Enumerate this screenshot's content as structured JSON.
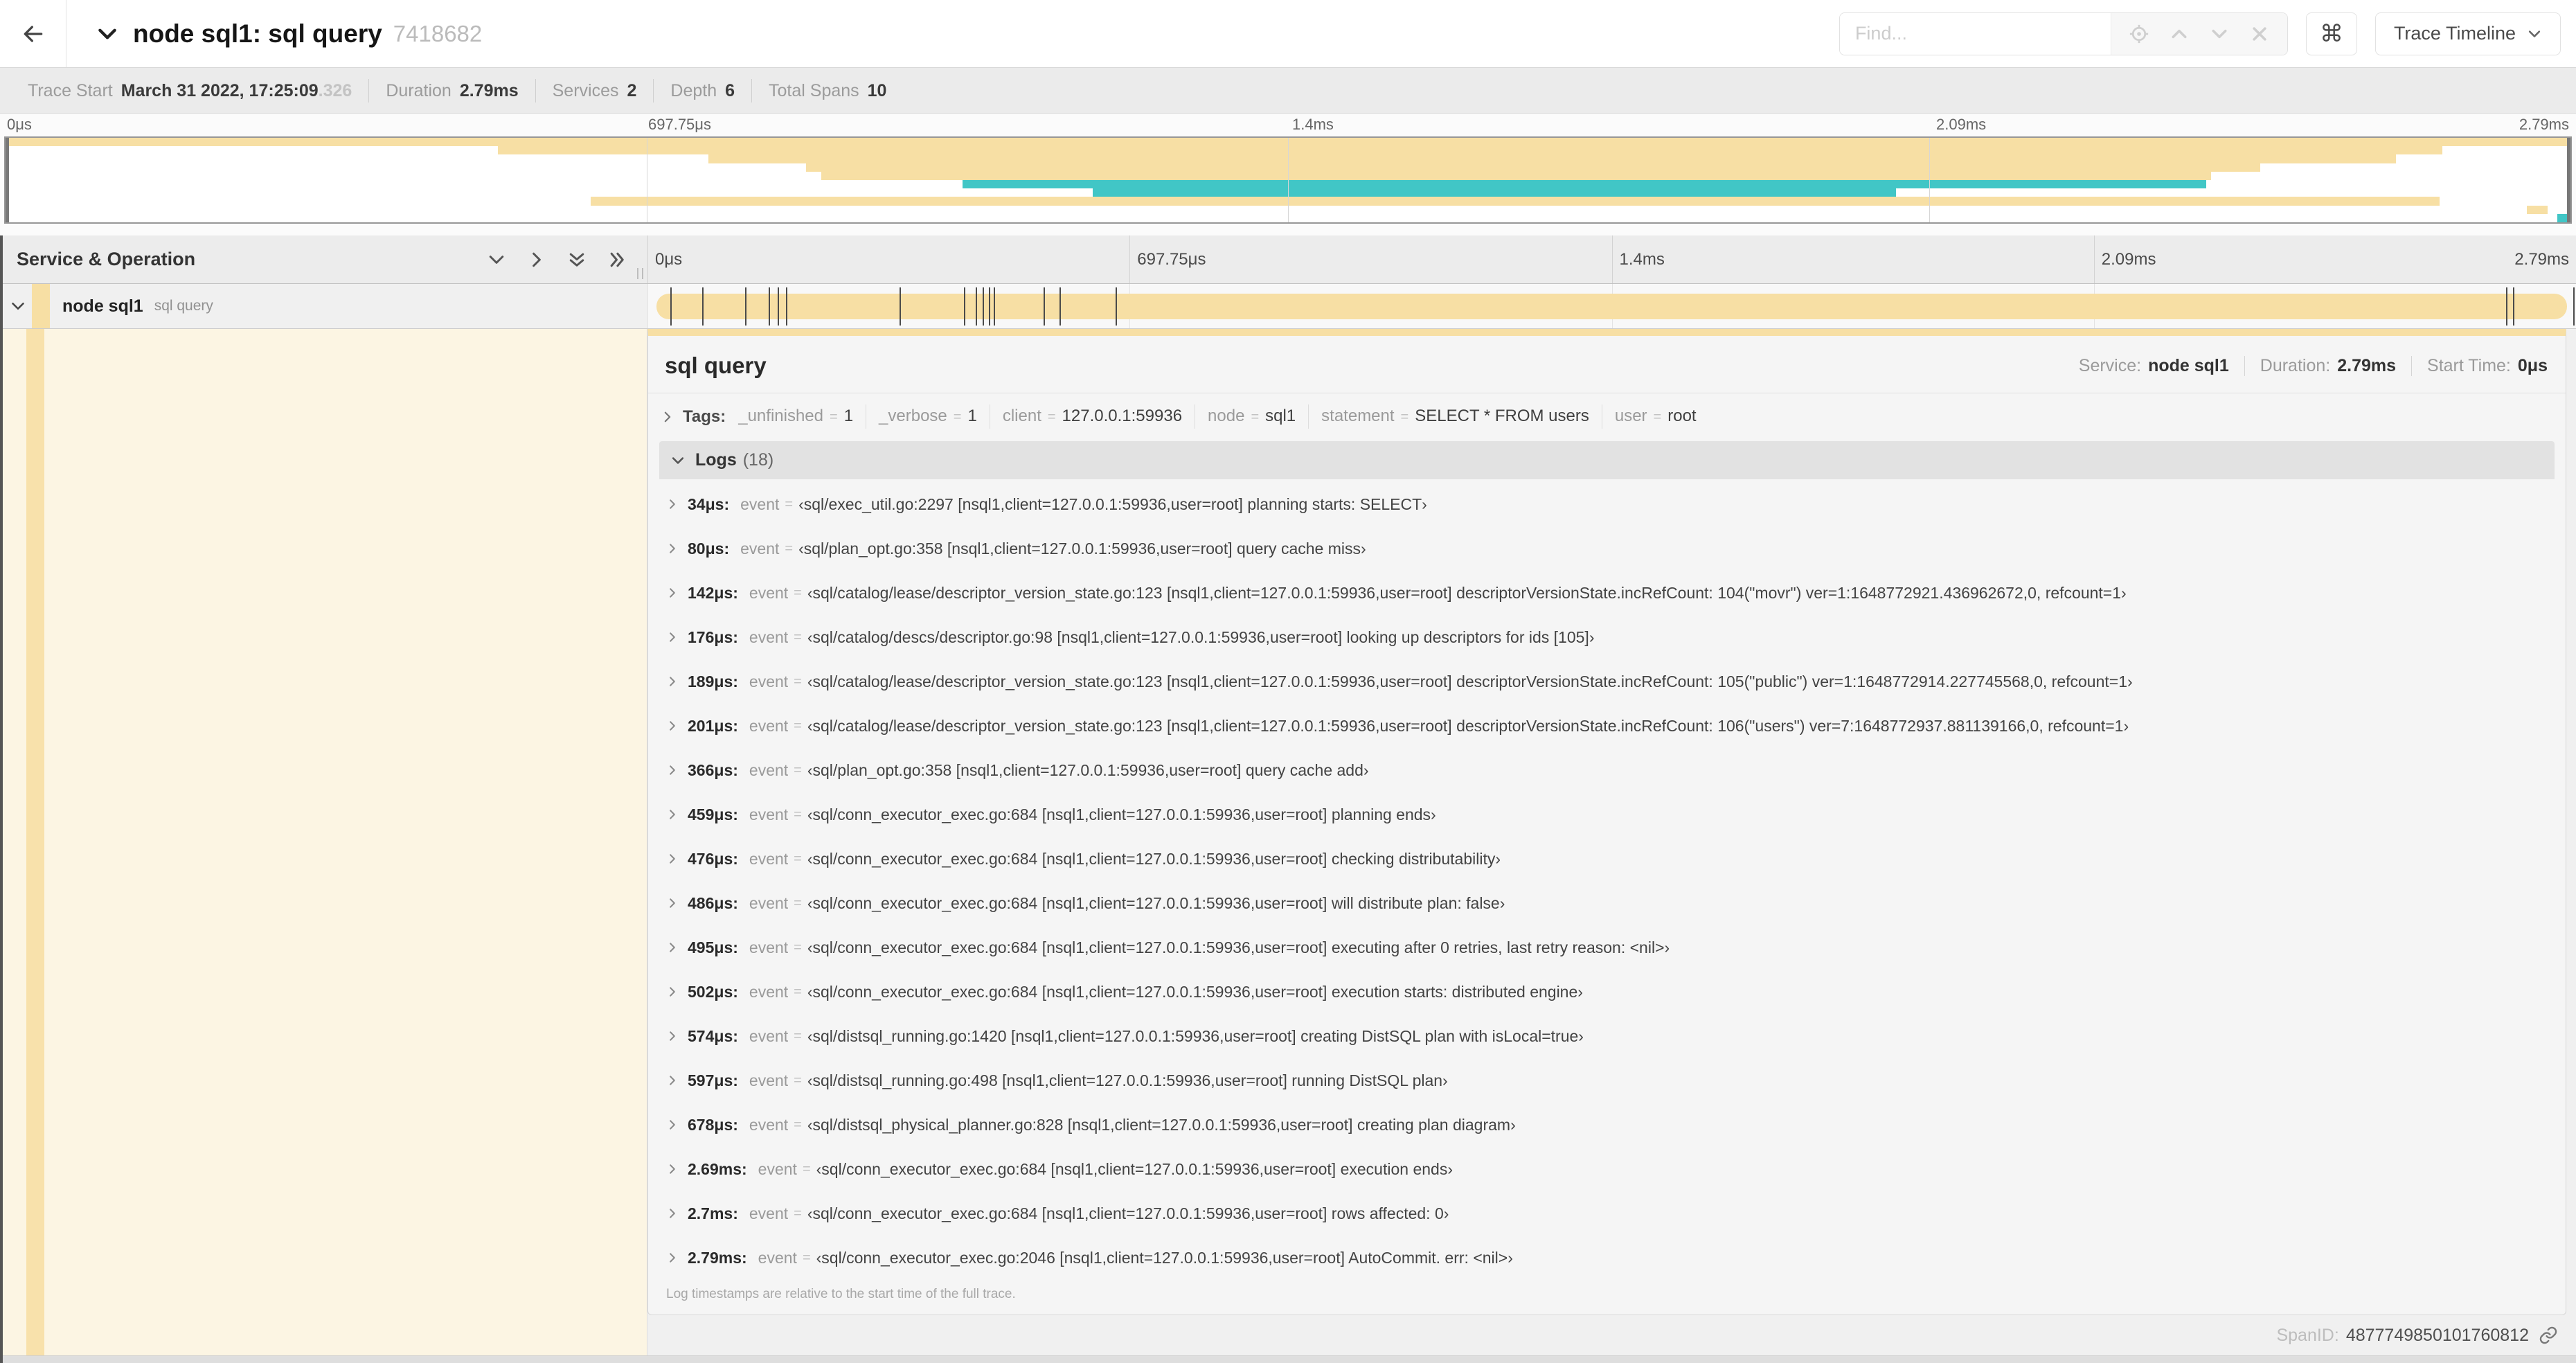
{
  "colors": {
    "span_bar": "#F7DFA4",
    "secondary_span": "#41C6C6",
    "detail_accent": "#F7DFA4"
  },
  "header": {
    "title": "node sql1: sql query",
    "trace_id": "7418682",
    "find_placeholder": "Find...",
    "command_icon": "⌘",
    "view_button": "Trace Timeline"
  },
  "summary": [
    {
      "label": "Trace Start",
      "value": "March 31 2022, 17:25:09",
      "suffix": ".326"
    },
    {
      "label": "Duration",
      "value": "2.79ms"
    },
    {
      "label": "Services",
      "value": "2"
    },
    {
      "label": "Depth",
      "value": "6"
    },
    {
      "label": "Total Spans",
      "value": "10"
    }
  ],
  "timeline": {
    "duration_us": 2790,
    "ticks": [
      "0μs",
      "697.75μs",
      "1.4ms",
      "2.09ms",
      "2.79ms"
    ],
    "service_operation_header": "Service & Operation",
    "row": {
      "service": "node sql1",
      "operation": "sql query"
    },
    "minimap_rows": [
      {
        "start_pct": 0,
        "end_pct": 100,
        "color": "#F7DFA4"
      },
      {
        "start_pct": 19.2,
        "end_pct": 95.0,
        "color": "#F7DFA4"
      },
      {
        "start_pct": 27.4,
        "end_pct": 93.2,
        "color": "#F7DFA4"
      },
      {
        "start_pct": 31.2,
        "end_pct": 87.9,
        "color": "#F7DFA4"
      },
      {
        "start_pct": 31.8,
        "end_pct": 86.0,
        "color": "#F7DFA4"
      },
      {
        "start_pct": 37.3,
        "end_pct": 85.8,
        "color": "#41C6C6"
      },
      {
        "start_pct": 42.4,
        "end_pct": 73.7,
        "color": "#41C6C6"
      },
      {
        "start_pct": 22.8,
        "end_pct": 94.9,
        "color": "#F7DFA4"
      },
      {
        "start_pct": 98.3,
        "end_pct": 99.1,
        "color": "#F7DFA4"
      },
      {
        "start_pct": 99.5,
        "end_pct": 100,
        "color": "#41C6C6"
      }
    ]
  },
  "detail": {
    "title": "sql query",
    "service": {
      "label": "Service:",
      "value": "node sql1"
    },
    "duration": {
      "label": "Duration:",
      "value": "2.79ms"
    },
    "start_time": {
      "label": "Start Time:",
      "value": "0μs"
    },
    "tags_label": "Tags:",
    "tags": [
      {
        "key": "_unfinished",
        "value": "1"
      },
      {
        "key": "_verbose",
        "value": "1"
      },
      {
        "key": "client",
        "value": "127.0.0.1:59936"
      },
      {
        "key": "node",
        "value": "sql1"
      },
      {
        "key": "statement",
        "value": "SELECT * FROM users"
      },
      {
        "key": "user",
        "value": "root"
      }
    ],
    "logs_label": "Logs",
    "logs_count": "(18)",
    "log_key": "event",
    "logs": [
      {
        "time": "34μs",
        "t_us": 34,
        "value": "‹sql/exec_util.go:2297 [nsql1,client=127.0.0.1:59936,user=root] planning starts: SELECT›"
      },
      {
        "time": "80μs",
        "t_us": 80,
        "value": "‹sql/plan_opt.go:358 [nsql1,client=127.0.0.1:59936,user=root] query cache miss›"
      },
      {
        "time": "142μs",
        "t_us": 142,
        "value": "‹sql/catalog/lease/descriptor_version_state.go:123 [nsql1,client=127.0.0.1:59936,user=root] descriptorVersionState.incRefCount: 104(\"movr\") ver=1:1648772921.436962672,0, refcount=1›"
      },
      {
        "time": "176μs",
        "t_us": 176,
        "value": "‹sql/catalog/descs/descriptor.go:98 [nsql1,client=127.0.0.1:59936,user=root] looking up descriptors for ids [105]›"
      },
      {
        "time": "189μs",
        "t_us": 189,
        "value": "‹sql/catalog/lease/descriptor_version_state.go:123 [nsql1,client=127.0.0.1:59936,user=root] descriptorVersionState.incRefCount: 105(\"public\") ver=1:1648772914.227745568,0, refcount=1›"
      },
      {
        "time": "201μs",
        "t_us": 201,
        "value": "‹sql/catalog/lease/descriptor_version_state.go:123 [nsql1,client=127.0.0.1:59936,user=root] descriptorVersionState.incRefCount: 106(\"users\") ver=7:1648772937.881139166,0, refcount=1›"
      },
      {
        "time": "366μs",
        "t_us": 366,
        "value": "‹sql/plan_opt.go:358 [nsql1,client=127.0.0.1:59936,user=root] query cache add›"
      },
      {
        "time": "459μs",
        "t_us": 459,
        "value": "‹sql/conn_executor_exec.go:684 [nsql1,client=127.0.0.1:59936,user=root] planning ends›"
      },
      {
        "time": "476μs",
        "t_us": 476,
        "value": "‹sql/conn_executor_exec.go:684 [nsql1,client=127.0.0.1:59936,user=root] checking distributability›"
      },
      {
        "time": "486μs",
        "t_us": 486,
        "value": "‹sql/conn_executor_exec.go:684 [nsql1,client=127.0.0.1:59936,user=root] will distribute plan: false›"
      },
      {
        "time": "495μs",
        "t_us": 495,
        "value": "‹sql/conn_executor_exec.go:684 [nsql1,client=127.0.0.1:59936,user=root] executing after 0 retries, last retry reason: <nil>›"
      },
      {
        "time": "502μs",
        "t_us": 502,
        "value": "‹sql/conn_executor_exec.go:684 [nsql1,client=127.0.0.1:59936,user=root] execution starts: distributed engine›"
      },
      {
        "time": "574μs",
        "t_us": 574,
        "value": "‹sql/distsql_running.go:1420 [nsql1,client=127.0.0.1:59936,user=root] creating DistSQL plan with isLocal=true›"
      },
      {
        "time": "597μs",
        "t_us": 597,
        "value": "‹sql/distsql_running.go:498 [nsql1,client=127.0.0.1:59936,user=root] running DistSQL plan›"
      },
      {
        "time": "678μs",
        "t_us": 678,
        "value": "‹sql/distsql_physical_planner.go:828 [nsql1,client=127.0.0.1:59936,user=root] creating plan diagram›"
      },
      {
        "time": "2.69ms",
        "t_us": 2690,
        "value": "‹sql/conn_executor_exec.go:684 [nsql1,client=127.0.0.1:59936,user=root] execution ends›"
      },
      {
        "time": "2.7ms",
        "t_us": 2700,
        "value": "‹sql/conn_executor_exec.go:684 [nsql1,client=127.0.0.1:59936,user=root] rows affected: 0›"
      },
      {
        "time": "2.79ms",
        "t_us": 2790,
        "value": "‹sql/conn_executor_exec.go:2046 [nsql1,client=127.0.0.1:59936,user=root] AutoCommit. err: <nil>›"
      }
    ],
    "footer_note": "Log timestamps are relative to the start time of the full trace.",
    "span_id_label": "SpanID:",
    "span_id": "4877749850101760812"
  }
}
